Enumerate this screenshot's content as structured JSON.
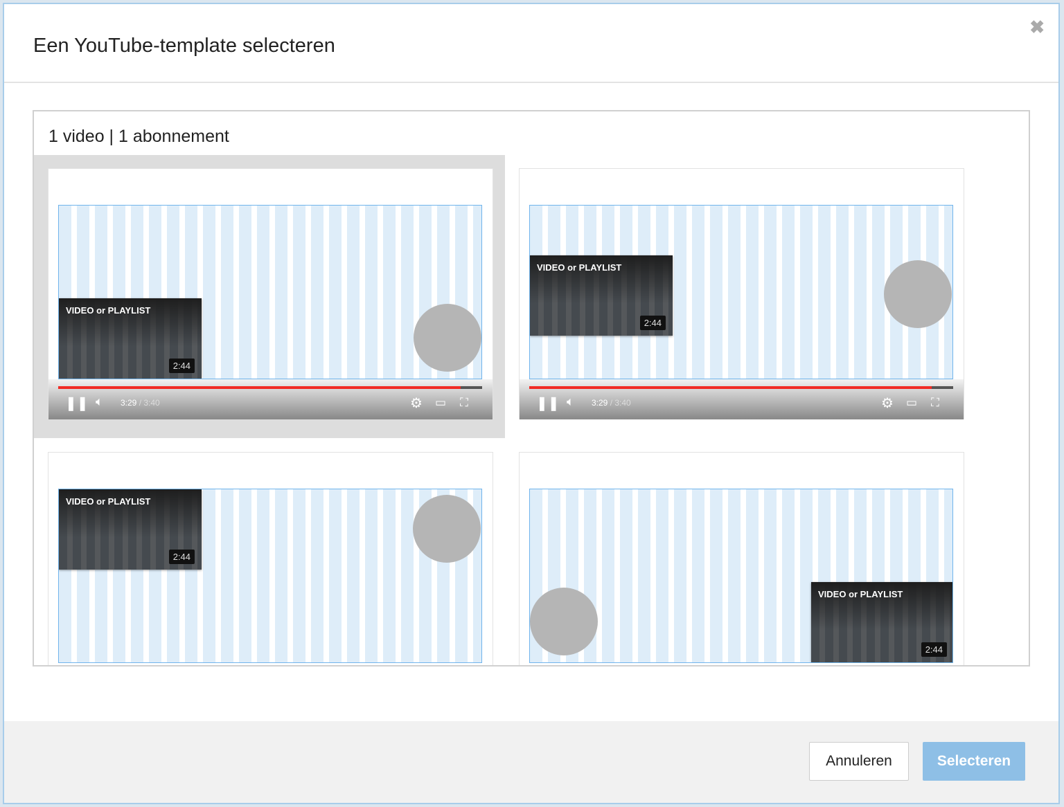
{
  "dialog": {
    "title": "Een YouTube-template selecteren",
    "close_icon": "close-icon"
  },
  "content": {
    "subtitle": "1 video | 1 abonnement"
  },
  "templates": [
    {
      "label": "VIDEO or PLAYLIST",
      "duration": "2:44",
      "selected": true,
      "player": {
        "current": "3:29",
        "separator": " / ",
        "total": "3:40",
        "progress": 0.95
      }
    },
    {
      "label": "VIDEO or PLAYLIST",
      "duration": "2:44",
      "selected": false,
      "player": {
        "current": "3:29",
        "separator": " / ",
        "total": "3:40",
        "progress": 0.95
      }
    },
    {
      "label": "VIDEO or PLAYLIST",
      "duration": "2:44",
      "selected": false
    },
    {
      "label": "VIDEO or PLAYLIST",
      "duration": "2:44",
      "selected": false
    }
  ],
  "footer": {
    "cancel": "Annuleren",
    "select": "Selecteren"
  },
  "colors": {
    "accent": "#8ebfe6",
    "progress": "#f12b24"
  }
}
